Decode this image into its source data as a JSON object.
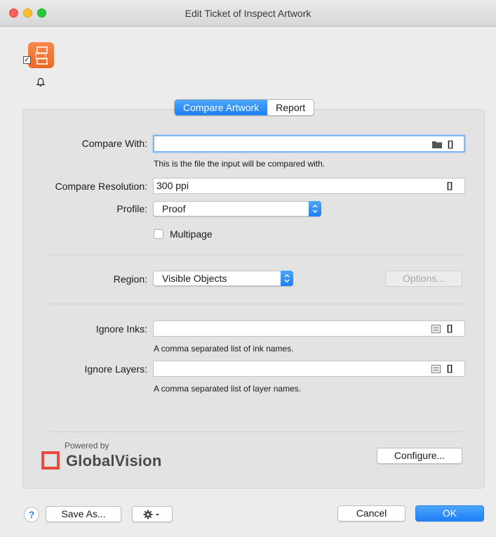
{
  "window": {
    "title": "Edit Ticket of Inspect Artwork"
  },
  "tabs": [
    {
      "label": "Compare Artwork",
      "active": true
    },
    {
      "label": "Report",
      "active": false
    }
  ],
  "form": {
    "compare_with": {
      "label": "Compare With:",
      "value": "",
      "help": "This is the file the input will be compared with."
    },
    "compare_resolution": {
      "label": "Compare Resolution:",
      "value": "300 ppi"
    },
    "profile": {
      "label": "Profile:",
      "value": "Proof"
    },
    "multipage": {
      "label": "Multipage",
      "checked": false
    },
    "region": {
      "label": "Region:",
      "value": "Visible Objects",
      "options_button": "Options..."
    },
    "ignore_inks": {
      "label": "Ignore Inks:",
      "value": "",
      "help": "A comma separated list of ink names."
    },
    "ignore_layers": {
      "label": "Ignore Layers:",
      "value": "",
      "help": "A comma separated list of layer names."
    }
  },
  "branding": {
    "powered_by": "Powered by",
    "name": "GlobalVision",
    "configure_button": "Configure..."
  },
  "footer": {
    "help": "?",
    "save_as": "Save As...",
    "cancel": "Cancel",
    "ok": "OK"
  },
  "colors": {
    "accent": "#1d7ff5",
    "brand": "#e94a3c",
    "app_icon": "#f07a3a"
  }
}
